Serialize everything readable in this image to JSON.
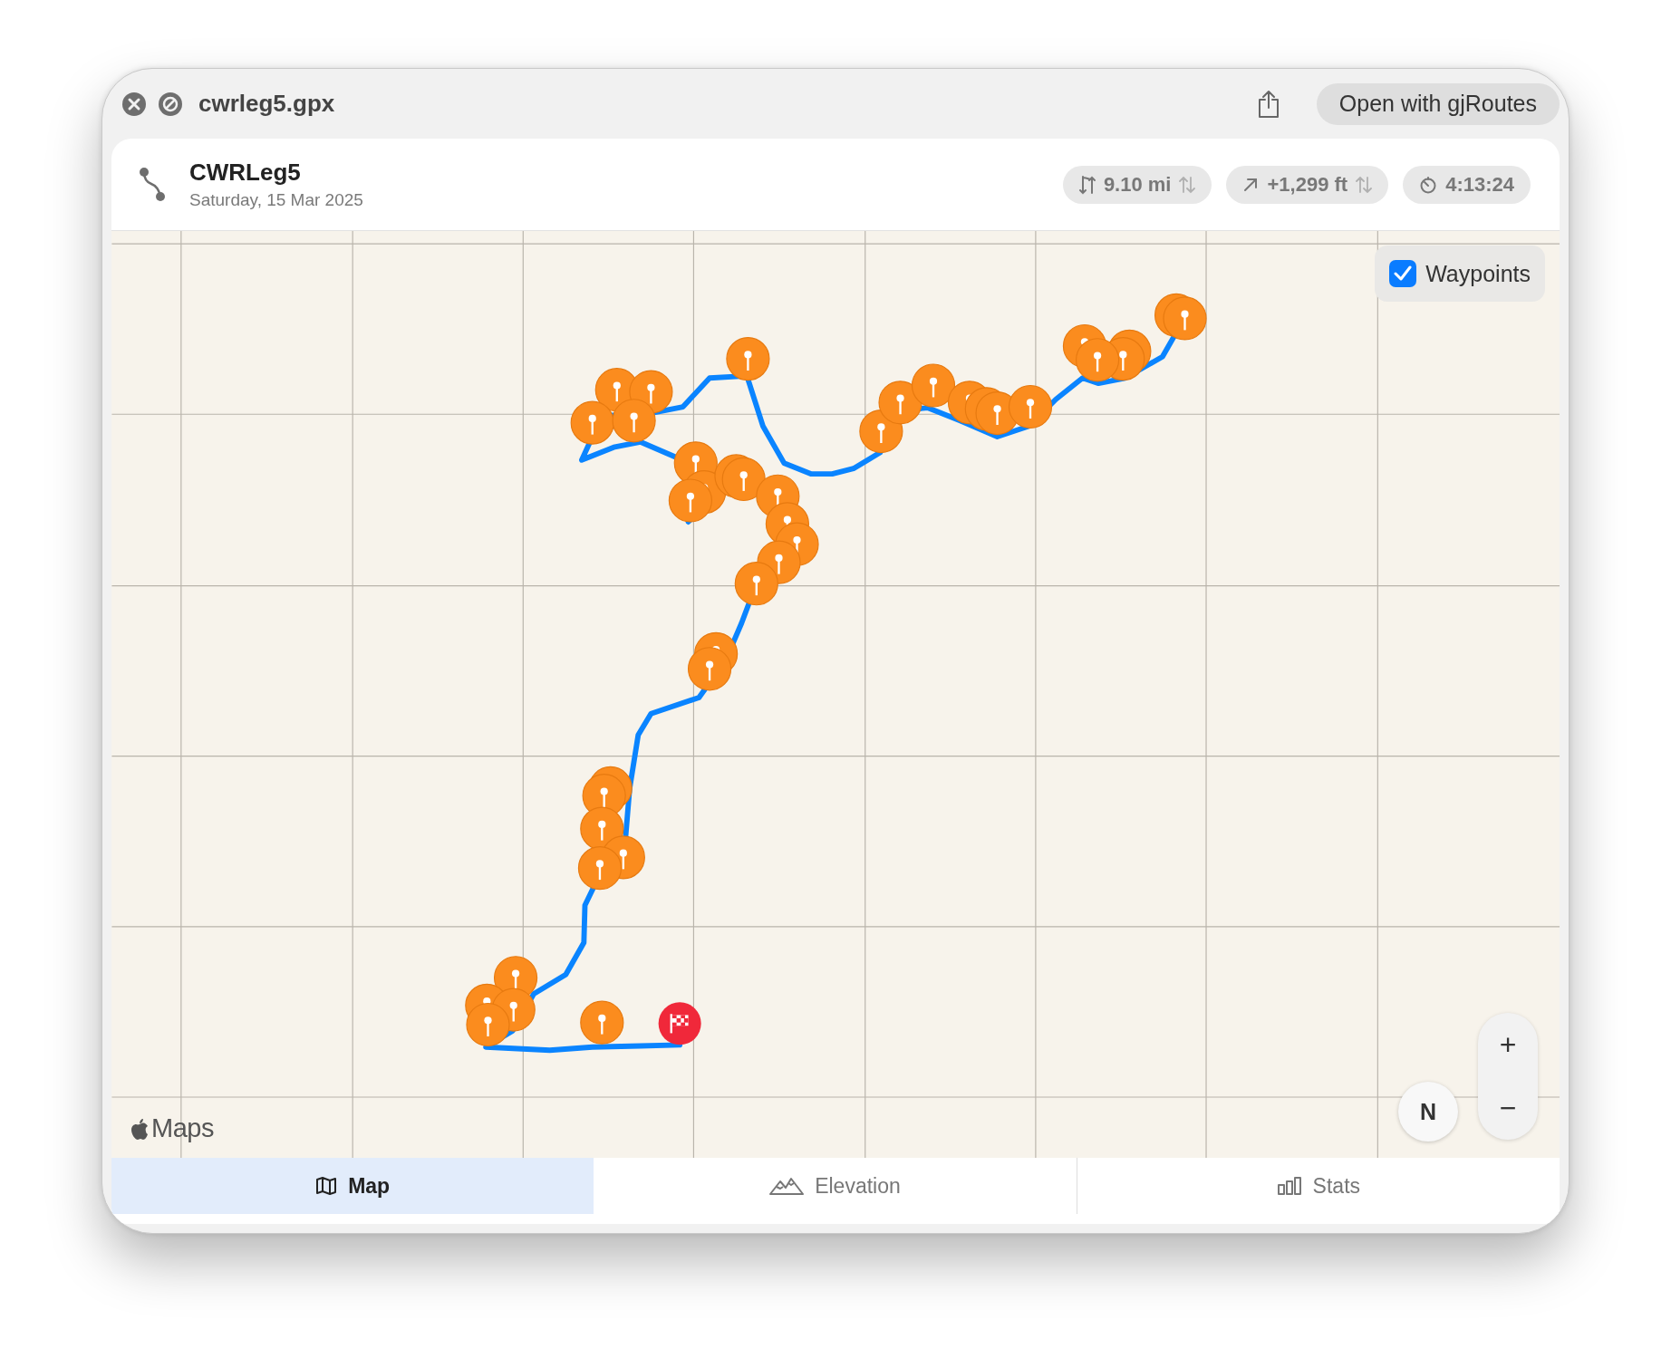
{
  "window": {
    "title": "cwrleg5.gpx",
    "open_button": "Open with gjRoutes"
  },
  "route": {
    "name": "CWRLeg5",
    "date": "Saturday, 15 Mar 2025"
  },
  "stats": [
    {
      "kind": "distance",
      "value": "9.10 mi",
      "switchable": true
    },
    {
      "kind": "ascent",
      "value": "+1,299 ft",
      "switchable": true
    },
    {
      "kind": "duration",
      "value": "4:13:24",
      "switchable": false
    }
  ],
  "map": {
    "waypoints_toggle": {
      "label": "Waypoints",
      "checked": true
    },
    "attribution": "Maps",
    "compass": "N",
    "zoom_in": "+",
    "zoom_out": "−"
  },
  "tabs": [
    {
      "kind": "map",
      "label": "Map",
      "selected": true
    },
    {
      "kind": "elevation",
      "label": "Elevation",
      "selected": false
    },
    {
      "kind": "stats",
      "label": "Stats",
      "selected": false
    }
  ]
}
